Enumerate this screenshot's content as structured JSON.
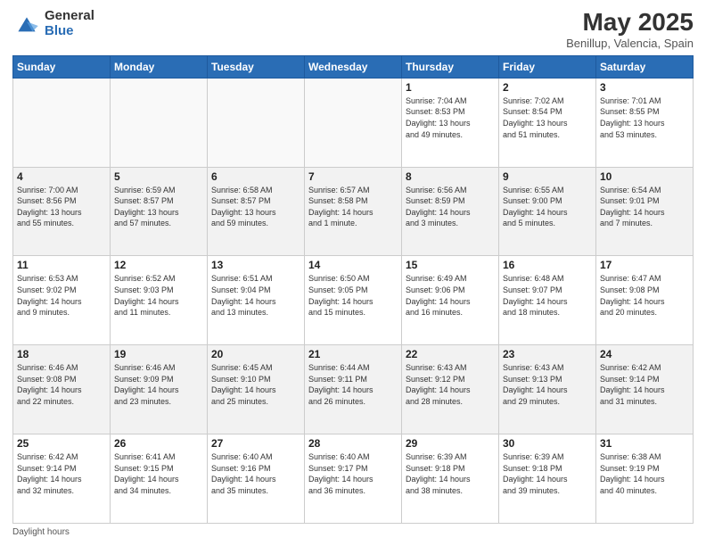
{
  "header": {
    "logo_general": "General",
    "logo_blue": "Blue",
    "main_title": "May 2025",
    "subtitle": "Benillup, Valencia, Spain"
  },
  "days_of_week": [
    "Sunday",
    "Monday",
    "Tuesday",
    "Wednesday",
    "Thursday",
    "Friday",
    "Saturday"
  ],
  "weeks": [
    [
      {
        "day": "",
        "info": ""
      },
      {
        "day": "",
        "info": ""
      },
      {
        "day": "",
        "info": ""
      },
      {
        "day": "",
        "info": ""
      },
      {
        "day": "1",
        "info": "Sunrise: 7:04 AM\nSunset: 8:53 PM\nDaylight: 13 hours\nand 49 minutes."
      },
      {
        "day": "2",
        "info": "Sunrise: 7:02 AM\nSunset: 8:54 PM\nDaylight: 13 hours\nand 51 minutes."
      },
      {
        "day": "3",
        "info": "Sunrise: 7:01 AM\nSunset: 8:55 PM\nDaylight: 13 hours\nand 53 minutes."
      }
    ],
    [
      {
        "day": "4",
        "info": "Sunrise: 7:00 AM\nSunset: 8:56 PM\nDaylight: 13 hours\nand 55 minutes."
      },
      {
        "day": "5",
        "info": "Sunrise: 6:59 AM\nSunset: 8:57 PM\nDaylight: 13 hours\nand 57 minutes."
      },
      {
        "day": "6",
        "info": "Sunrise: 6:58 AM\nSunset: 8:57 PM\nDaylight: 13 hours\nand 59 minutes."
      },
      {
        "day": "7",
        "info": "Sunrise: 6:57 AM\nSunset: 8:58 PM\nDaylight: 14 hours\nand 1 minute."
      },
      {
        "day": "8",
        "info": "Sunrise: 6:56 AM\nSunset: 8:59 PM\nDaylight: 14 hours\nand 3 minutes."
      },
      {
        "day": "9",
        "info": "Sunrise: 6:55 AM\nSunset: 9:00 PM\nDaylight: 14 hours\nand 5 minutes."
      },
      {
        "day": "10",
        "info": "Sunrise: 6:54 AM\nSunset: 9:01 PM\nDaylight: 14 hours\nand 7 minutes."
      }
    ],
    [
      {
        "day": "11",
        "info": "Sunrise: 6:53 AM\nSunset: 9:02 PM\nDaylight: 14 hours\nand 9 minutes."
      },
      {
        "day": "12",
        "info": "Sunrise: 6:52 AM\nSunset: 9:03 PM\nDaylight: 14 hours\nand 11 minutes."
      },
      {
        "day": "13",
        "info": "Sunrise: 6:51 AM\nSunset: 9:04 PM\nDaylight: 14 hours\nand 13 minutes."
      },
      {
        "day": "14",
        "info": "Sunrise: 6:50 AM\nSunset: 9:05 PM\nDaylight: 14 hours\nand 15 minutes."
      },
      {
        "day": "15",
        "info": "Sunrise: 6:49 AM\nSunset: 9:06 PM\nDaylight: 14 hours\nand 16 minutes."
      },
      {
        "day": "16",
        "info": "Sunrise: 6:48 AM\nSunset: 9:07 PM\nDaylight: 14 hours\nand 18 minutes."
      },
      {
        "day": "17",
        "info": "Sunrise: 6:47 AM\nSunset: 9:08 PM\nDaylight: 14 hours\nand 20 minutes."
      }
    ],
    [
      {
        "day": "18",
        "info": "Sunrise: 6:46 AM\nSunset: 9:08 PM\nDaylight: 14 hours\nand 22 minutes."
      },
      {
        "day": "19",
        "info": "Sunrise: 6:46 AM\nSunset: 9:09 PM\nDaylight: 14 hours\nand 23 minutes."
      },
      {
        "day": "20",
        "info": "Sunrise: 6:45 AM\nSunset: 9:10 PM\nDaylight: 14 hours\nand 25 minutes."
      },
      {
        "day": "21",
        "info": "Sunrise: 6:44 AM\nSunset: 9:11 PM\nDaylight: 14 hours\nand 26 minutes."
      },
      {
        "day": "22",
        "info": "Sunrise: 6:43 AM\nSunset: 9:12 PM\nDaylight: 14 hours\nand 28 minutes."
      },
      {
        "day": "23",
        "info": "Sunrise: 6:43 AM\nSunset: 9:13 PM\nDaylight: 14 hours\nand 29 minutes."
      },
      {
        "day": "24",
        "info": "Sunrise: 6:42 AM\nSunset: 9:14 PM\nDaylight: 14 hours\nand 31 minutes."
      }
    ],
    [
      {
        "day": "25",
        "info": "Sunrise: 6:42 AM\nSunset: 9:14 PM\nDaylight: 14 hours\nand 32 minutes."
      },
      {
        "day": "26",
        "info": "Sunrise: 6:41 AM\nSunset: 9:15 PM\nDaylight: 14 hours\nand 34 minutes."
      },
      {
        "day": "27",
        "info": "Sunrise: 6:40 AM\nSunset: 9:16 PM\nDaylight: 14 hours\nand 35 minutes."
      },
      {
        "day": "28",
        "info": "Sunrise: 6:40 AM\nSunset: 9:17 PM\nDaylight: 14 hours\nand 36 minutes."
      },
      {
        "day": "29",
        "info": "Sunrise: 6:39 AM\nSunset: 9:18 PM\nDaylight: 14 hours\nand 38 minutes."
      },
      {
        "day": "30",
        "info": "Sunrise: 6:39 AM\nSunset: 9:18 PM\nDaylight: 14 hours\nand 39 minutes."
      },
      {
        "day": "31",
        "info": "Sunrise: 6:38 AM\nSunset: 9:19 PM\nDaylight: 14 hours\nand 40 minutes."
      }
    ]
  ],
  "footer": {
    "note": "Daylight hours"
  }
}
